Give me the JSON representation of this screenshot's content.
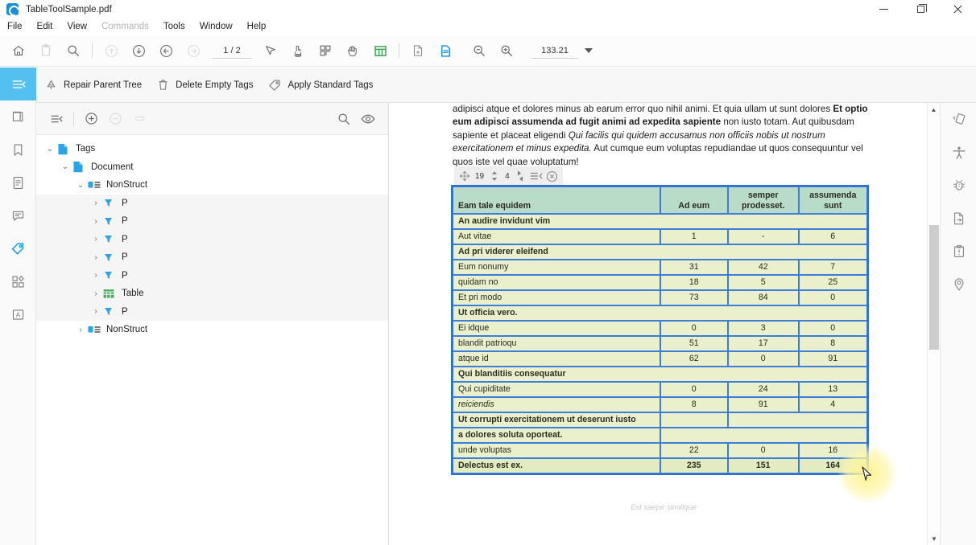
{
  "window": {
    "title": "TableToolSample.pdf",
    "app_icon": "acrobat-logo-icon",
    "controls": {
      "minimize": "minimize-icon",
      "restore": "restore-icon",
      "close": "close-icon"
    }
  },
  "menubar": {
    "items": [
      {
        "label": "File",
        "disabled": false
      },
      {
        "label": "Edit",
        "disabled": false
      },
      {
        "label": "View",
        "disabled": false
      },
      {
        "label": "Commands",
        "disabled": true
      },
      {
        "label": "Tools",
        "disabled": false
      },
      {
        "label": "Window",
        "disabled": false
      },
      {
        "label": "Help",
        "disabled": false
      }
    ]
  },
  "toolbar": {
    "page_value": "1 / 2",
    "zoom_value": "133.21",
    "icons": [
      "home-icon",
      "file-icon",
      "search-icon",
      "first-page-icon",
      "next-page-icon",
      "previous-page-icon",
      "last-page-icon",
      "select-cursor-icon",
      "touch-mode-icon",
      "page-thumbnails-icon",
      "hand-tool-icon",
      "table-tool-icon",
      "add-page-icon",
      "page-properties-icon",
      "zoom-out-icon",
      "zoom-in-icon",
      "zoom-dropdown-caret-icon"
    ]
  },
  "tag_actions": {
    "buttons": [
      {
        "label": "Repair Parent Tree",
        "icon": "repair-tree-icon"
      },
      {
        "label": "Delete Empty Tags",
        "icon": "trash-icon"
      },
      {
        "label": "Apply Standard Tags",
        "icon": "tag-icon"
      }
    ]
  },
  "left_rail": {
    "items": [
      {
        "name": "toggle-sidebar",
        "icon": "collapse-panel-icon",
        "active": true
      },
      {
        "name": "page-thumbnails",
        "icon": "pages-icon",
        "active": false
      },
      {
        "name": "bookmarks",
        "icon": "bookmark-icon",
        "active": false
      },
      {
        "name": "page-content",
        "icon": "document-icon",
        "active": false
      },
      {
        "name": "comments",
        "icon": "comment-icon",
        "active": false
      },
      {
        "name": "tags",
        "icon": "tag-icon",
        "active": true
      },
      {
        "name": "content-objects",
        "icon": "objects-icon",
        "active": false
      },
      {
        "name": "text-recognition",
        "icon": "letter-a-icon",
        "active": false
      }
    ]
  },
  "right_rail": {
    "items": [
      {
        "name": "pages-tool",
        "icon": "page-rotate-icon"
      },
      {
        "name": "accessibility",
        "icon": "accessibility-person-icon"
      },
      {
        "name": "preflight",
        "icon": "bug-icon"
      },
      {
        "name": "export-page",
        "icon": "page-export-icon"
      },
      {
        "name": "alerts",
        "icon": "clipboard-alert-icon"
      },
      {
        "name": "location",
        "icon": "map-pin-icon"
      }
    ]
  },
  "tags_panel": {
    "toolbar_icons": [
      "options-menu-icon",
      "add-tag-icon",
      "remove-tag-icon",
      "edit-tag-icon",
      "find-icon",
      "highlight-content-icon"
    ],
    "tree": [
      {
        "label": "Tags",
        "depth": 0,
        "icon": "tags-root-icon",
        "twisty": "expanded",
        "zebra": false
      },
      {
        "label": "Document",
        "depth": 1,
        "icon": "document-tag-icon",
        "twisty": "expanded",
        "zebra": false
      },
      {
        "label": "NonStruct",
        "depth": 2,
        "icon": "nonstruct-icon",
        "twisty": "expanded",
        "zebra": false
      },
      {
        "label": "P",
        "depth": 3,
        "icon": "paragraph-icon",
        "twisty": "collapsed",
        "zebra": true
      },
      {
        "label": "P",
        "depth": 3,
        "icon": "paragraph-icon",
        "twisty": "collapsed",
        "zebra": true
      },
      {
        "label": "P",
        "depth": 3,
        "icon": "paragraph-icon",
        "twisty": "collapsed",
        "zebra": true
      },
      {
        "label": "P",
        "depth": 3,
        "icon": "paragraph-icon",
        "twisty": "collapsed",
        "zebra": true
      },
      {
        "label": "P",
        "depth": 3,
        "icon": "paragraph-icon",
        "twisty": "collapsed",
        "zebra": true
      },
      {
        "label": "Table",
        "depth": 3,
        "icon": "table-tag-icon",
        "twisty": "collapsed",
        "zebra": true
      },
      {
        "label": "P",
        "depth": 3,
        "icon": "paragraph-icon",
        "twisty": "collapsed",
        "zebra": true
      },
      {
        "label": "NonStruct",
        "depth": 2,
        "icon": "nonstruct-icon",
        "twisty": "collapsed",
        "zebra": false
      }
    ]
  },
  "document": {
    "paragraph_html": "adipisci atque et dolores minus ab earum error quo nihil animi. Et quia ullam ut sunt dolores <b>Et optio eum adipisci assumenda ad fugit animi ad expedita sapiente</b> non iusto totam. Aut quibusdam sapiente et placeat eligendi <i>Qui facilis qui quidem accusamus non officiis nobis ut nostrum exercitationem et minus expedita.</i> Aut cumque eum voluptas repudiandae ut quos consequuntur vel quos iste vel quae voluptatum!",
    "footer": "Est saepe similique",
    "table_toolbar": {
      "move_icon": "move-handle-icon",
      "rows_value": "19",
      "rows_stepper_icon": "row-stepper-icon",
      "cols_value": "4",
      "cols_stepper_icon": "column-stepper-icon",
      "options_icon": "table-options-icon",
      "close_icon": "close-circle-icon"
    },
    "table": {
      "headers": [
        "Eam tale equidem",
        "Ad eum",
        "semper prodesset.",
        "assumenda sunt"
      ],
      "rows": [
        {
          "type": "section",
          "label": "An audire invidunt vim",
          "values": []
        },
        {
          "type": "data",
          "label": "Aut vitae",
          "values": [
            "1",
            "-",
            "6"
          ]
        },
        {
          "type": "section",
          "label": "Ad pri viderer eleifend",
          "values": []
        },
        {
          "type": "data",
          "label": "Eum nonumy",
          "values": [
            "31",
            "42",
            "7"
          ]
        },
        {
          "type": "data",
          "label": "quidam no",
          "values": [
            "18",
            "5",
            "25"
          ]
        },
        {
          "type": "data",
          "label": "Et pri modo",
          "values": [
            "73",
            "84",
            "0"
          ]
        },
        {
          "type": "section",
          "label": "Ut officia vero.",
          "values": []
        },
        {
          "type": "data",
          "label": "Ei idque",
          "values": [
            "0",
            "3",
            "0"
          ]
        },
        {
          "type": "data",
          "label": "blandit patrioqu",
          "values": [
            "51",
            "17",
            "8"
          ]
        },
        {
          "type": "data",
          "label": "atque id",
          "values": [
            "62",
            "0",
            "91"
          ]
        },
        {
          "type": "section",
          "label": "Qui blanditiis consequatur",
          "values": []
        },
        {
          "type": "data",
          "label": "Qui cupiditate",
          "values": [
            "0",
            "24",
            "13"
          ]
        },
        {
          "type": "data-italic",
          "label": "reiciendis",
          "values": [
            "8",
            "91",
            "4"
          ]
        },
        {
          "type": "section-split",
          "label": "Ut corrupti exercitationem ut deserunt iusto",
          "values": []
        },
        {
          "type": "section-split2",
          "label": "a dolores soluta oporteat.",
          "values": []
        },
        {
          "type": "data",
          "label": "unde voluptas",
          "values": [
            "22",
            "0",
            "16"
          ]
        },
        {
          "type": "total",
          "label": "Delectus est ex.",
          "values": [
            "235",
            "151",
            "164"
          ]
        }
      ]
    }
  },
  "scrollbar": {
    "up_arrow": "chevron-up-icon",
    "down_arrow": "chevron-down-icon"
  },
  "colors": {
    "accent_blue": "#1a9fe0",
    "rail_active": "#54c0f0",
    "table_header_bg": "#b9dcc9",
    "table_body_bg": "#e9f0cb",
    "table_border": "#3b7dd8",
    "cursor_glow": "#fff28c"
  }
}
